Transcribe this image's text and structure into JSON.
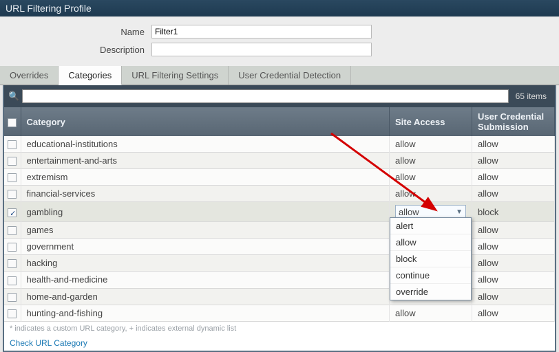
{
  "window": {
    "title": "URL Filtering Profile"
  },
  "form": {
    "name_label": "Name",
    "name_value": "Filter1",
    "desc_label": "Description",
    "desc_value": ""
  },
  "tabs": {
    "overrides": "Overrides",
    "categories": "Categories",
    "filtering": "URL Filtering Settings",
    "credential": "User Credential Detection"
  },
  "table": {
    "search_value": "",
    "items_count": "65 items",
    "headers": {
      "category": "Category",
      "site_access": "Site Access",
      "credential": "User Credential Submission"
    },
    "rows": [
      {
        "checked": false,
        "category": "educational-institutions",
        "site_access": "allow",
        "credential": "allow"
      },
      {
        "checked": false,
        "category": "entertainment-and-arts",
        "site_access": "allow",
        "credential": "allow"
      },
      {
        "checked": false,
        "category": "extremism",
        "site_access": "allow",
        "credential": "allow"
      },
      {
        "checked": false,
        "category": "financial-services",
        "site_access": "allow",
        "credential": "allow"
      },
      {
        "checked": true,
        "category": "gambling",
        "site_access": "allow",
        "credential": "block",
        "dd_open": true
      },
      {
        "checked": false,
        "category": "games",
        "site_access": "",
        "credential": "allow"
      },
      {
        "checked": false,
        "category": "government",
        "site_access": "",
        "credential": "allow"
      },
      {
        "checked": false,
        "category": "hacking",
        "site_access": "",
        "credential": "allow"
      },
      {
        "checked": false,
        "category": "health-and-medicine",
        "site_access": "",
        "credential": "allow"
      },
      {
        "checked": false,
        "category": "home-and-garden",
        "site_access": "",
        "credential": "allow"
      },
      {
        "checked": false,
        "category": "hunting-and-fishing",
        "site_access": "allow",
        "credential": "allow"
      }
    ],
    "dropdown_options": [
      "alert",
      "allow",
      "block",
      "continue",
      "override"
    ]
  },
  "footer": {
    "note": "* indicates a custom URL category, + indicates external dynamic list",
    "check_link": "Check URL Category"
  }
}
